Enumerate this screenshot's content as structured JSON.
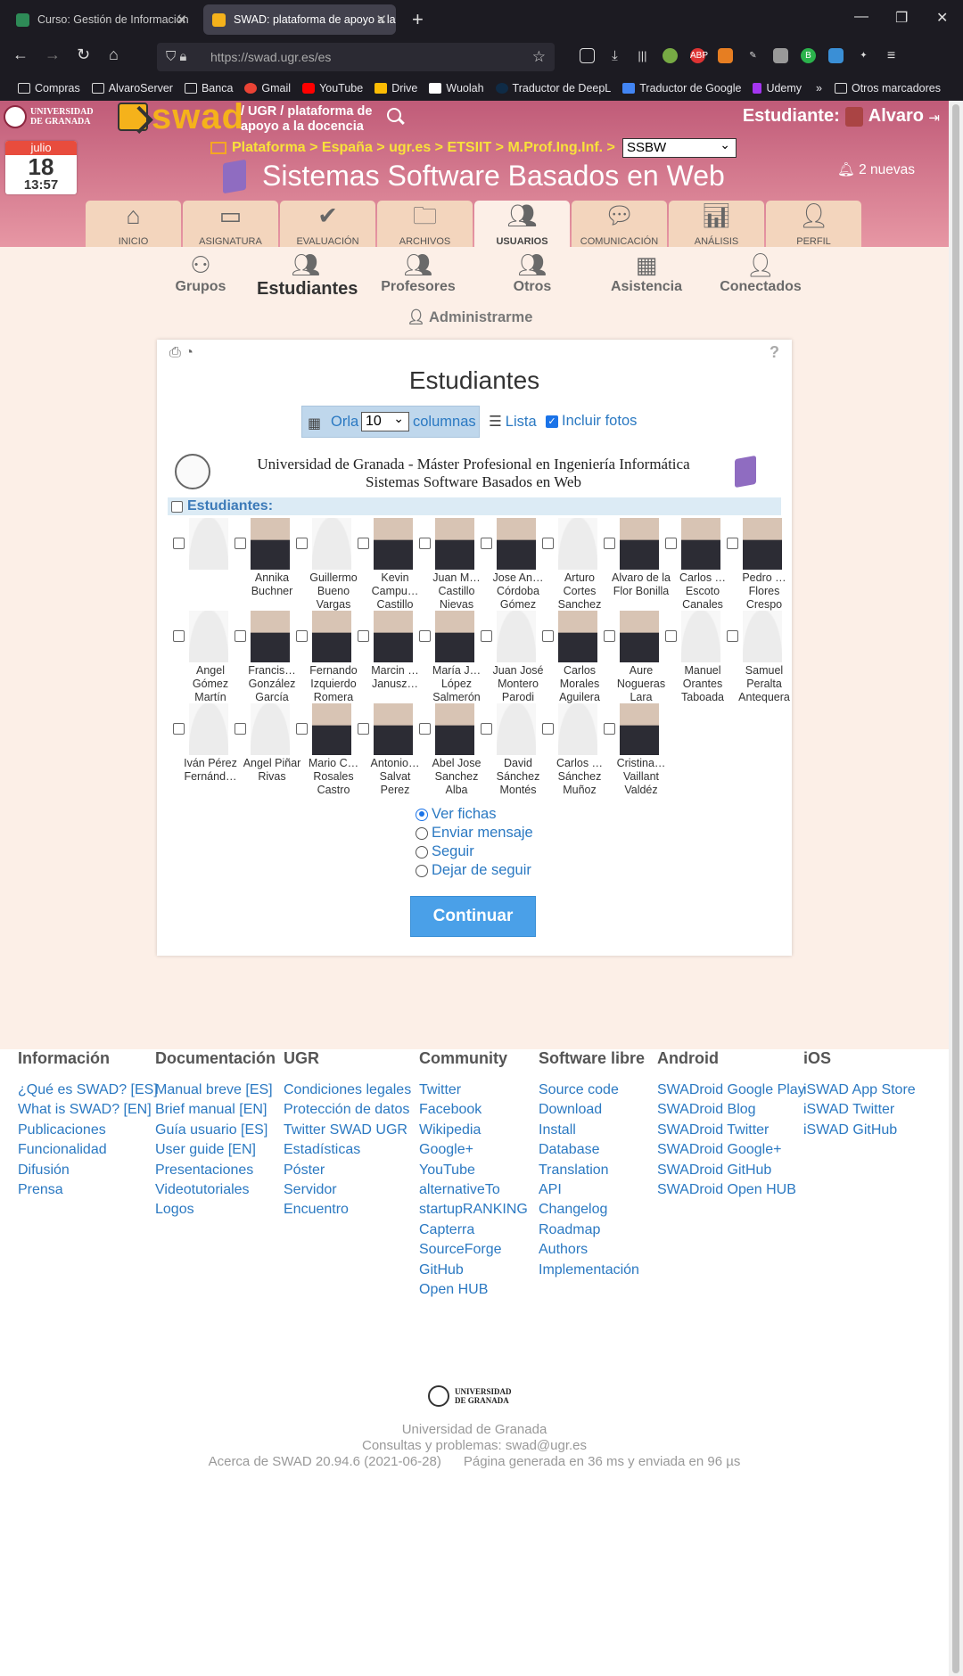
{
  "browser": {
    "tabs": [
      {
        "title": "Curso: Gestión de Información",
        "icon": "moodle-icon"
      },
      {
        "title": "SWAD: plataforma de apoyo a la",
        "icon": "swad-icon"
      }
    ],
    "url": "https://swad.ugr.es/es",
    "bookmarks": [
      "Compras",
      "AlvaroServer",
      "Banca",
      "Gmail",
      "YouTube",
      "Drive",
      "Wuolah",
      "Traductor de DeepL",
      "Traductor de Google",
      "Udemy"
    ],
    "other_bookmarks": "Otros marcadores"
  },
  "header": {
    "ugr_logo_text": [
      "UNIVERSIDAD",
      "DE GRANADA"
    ],
    "swad_logo": "swad",
    "tagline": "/ UGR / plataforma de apoyo a la docencia",
    "role_label": "Estudiante:",
    "user_name": "Alvaro",
    "calendar": {
      "month": "julio",
      "day": "18",
      "time": "13:57"
    },
    "breadcrumb": "Plataforma > España > ugr.es > ETSIIT > M.Prof.Ing.Inf. >",
    "course_select": "SSBW",
    "course_title": "Sistemas Software Basados en Web",
    "notifications": "2 nuevas"
  },
  "main_tabs": [
    {
      "label": "INICIO",
      "icon": "home-icon"
    },
    {
      "label": "ASIGNATURA",
      "icon": "chalkboard-icon"
    },
    {
      "label": "EVALUACIÓN",
      "icon": "check-icon"
    },
    {
      "label": "ARCHIVOS",
      "icon": "folder-icon"
    },
    {
      "label": "USUARIOS",
      "icon": "users-icon",
      "active": true
    },
    {
      "label": "COMUNICACIÓN",
      "icon": "comment-icon"
    },
    {
      "label": "ANÁLISIS",
      "icon": "chart-icon"
    },
    {
      "label": "PERFIL",
      "icon": "user-icon"
    }
  ],
  "sub_tabs": [
    {
      "label": "Grupos",
      "icon": "sitemap-icon"
    },
    {
      "label": "Estudiantes",
      "icon": "users-icon",
      "active": true
    },
    {
      "label": "Profesores",
      "icon": "teacher-icon"
    },
    {
      "label": "Otros",
      "icon": "user-friends-icon"
    },
    {
      "label": "Asistencia",
      "icon": "calendar-check-icon"
    },
    {
      "label": "Conectados",
      "icon": "user-clock-icon"
    }
  ],
  "admin_link": "Administrarme",
  "card": {
    "title": "Estudiantes",
    "view": {
      "orla": "Orla",
      "columns_value": "10",
      "columns_label": "columnas",
      "list": "Lista",
      "include_photos": "Incluir fotos"
    },
    "university_line1": "Universidad de Granada - Máster Profesional en Ingeniería Informática",
    "university_line2": "Sistemas Software Basados en Web",
    "students_header": "Estudiantes:",
    "students": [
      {
        "name": "",
        "photo": false
      },
      {
        "name": "Annika Buchner",
        "photo": true
      },
      {
        "name": "Guillermo Bueno Vargas",
        "photo": false
      },
      {
        "name": "Kevin Campu… Castillo",
        "photo": true
      },
      {
        "name": "Juan M… Castillo Nievas",
        "photo": true
      },
      {
        "name": "Jose An… Córdoba Gómez",
        "photo": true
      },
      {
        "name": "Arturo Cortes Sanchez",
        "photo": false
      },
      {
        "name": "Alvaro de la Flor Bonilla",
        "photo": true
      },
      {
        "name": "Carlos … Escoto Canales",
        "photo": true
      },
      {
        "name": "Pedro … Flores Crespo",
        "photo": true
      },
      {
        "name": "Angel Gómez Martín",
        "photo": false
      },
      {
        "name": "Francis… González García",
        "photo": true
      },
      {
        "name": "Fernando Izquierdo Romera",
        "photo": true
      },
      {
        "name": "Marcin … Janusz…",
        "photo": true
      },
      {
        "name": "María J… López Salmerón",
        "photo": true
      },
      {
        "name": "Juan José Montero Parodi",
        "photo": false
      },
      {
        "name": "Carlos Morales Aguilera",
        "photo": true
      },
      {
        "name": "Aure Nogueras Lara",
        "photo": true
      },
      {
        "name": "Manuel Orantes Taboada",
        "photo": false
      },
      {
        "name": "Samuel Peralta Antequera",
        "photo": false
      },
      {
        "name": "Iván Pérez Fernánd…",
        "photo": false
      },
      {
        "name": "Angel Piñar Rivas",
        "photo": false
      },
      {
        "name": "Mario C… Rosales Castro",
        "photo": true
      },
      {
        "name": "Antonio… Salvat Perez",
        "photo": true
      },
      {
        "name": "Abel Jose Sanchez Alba",
        "photo": true
      },
      {
        "name": "David Sánchez Montés",
        "photo": false
      },
      {
        "name": "Carlos … Sánchez Muñoz",
        "photo": false
      },
      {
        "name": "Cristina… Vaillant Valdéz",
        "photo": true
      }
    ],
    "actions": [
      {
        "label": "Ver fichas",
        "selected": true
      },
      {
        "label": "Enviar mensaje",
        "selected": false
      },
      {
        "label": "Seguir",
        "selected": false
      },
      {
        "label": "Dejar de seguir",
        "selected": false
      }
    ],
    "submit": "Continuar"
  },
  "footer": {
    "columns": [
      {
        "title": "Información",
        "links": [
          "¿Qué es SWAD? [ES]",
          "What is SWAD? [EN]",
          "Publicaciones",
          "Funcionalidad",
          "Difusión",
          "Prensa"
        ]
      },
      {
        "title": "Documentación",
        "links": [
          "Manual breve [ES]",
          "Brief manual [EN]",
          "Guía usuario [ES]",
          "User guide [EN]",
          "Presentaciones",
          "Videotutoriales",
          "Logos"
        ]
      },
      {
        "title": "UGR",
        "links": [
          "Condiciones legales",
          "Protección de datos",
          "Twitter SWAD UGR",
          "Estadísticas",
          "Póster",
          "Servidor",
          "Encuentro"
        ]
      },
      {
        "title": "Community",
        "links": [
          "Twitter",
          "Facebook",
          "Wikipedia",
          "Google+",
          "YouTube",
          "alternativeTo",
          "startupRANKING",
          "Capterra",
          "SourceForge",
          "GitHub",
          "Open HUB"
        ]
      },
      {
        "title": "Software libre",
        "links": [
          "Source code",
          "Download",
          "Install",
          "Database",
          "Translation",
          "API",
          "Changelog",
          "Roadmap",
          "Authors",
          "Implementación"
        ]
      },
      {
        "title": "Android",
        "links": [
          "SWADroid Google Play",
          "SWADroid Blog",
          "SWADroid Twitter",
          "SWADroid Google+",
          "SWADroid GitHub",
          "SWADroid Open HUB"
        ]
      },
      {
        "title": "iOS",
        "links": [
          "iSWAD App Store",
          "iSWAD Twitter",
          "iSWAD GitHub"
        ]
      }
    ],
    "university": "Universidad de Granada",
    "contact": "Consultas y problemas: swad@ugr.es",
    "about": "Acerca de SWAD 20.94.6 (2021-06-28)",
    "timing": "Página generada en 36 ms y enviada en 96 µs"
  }
}
